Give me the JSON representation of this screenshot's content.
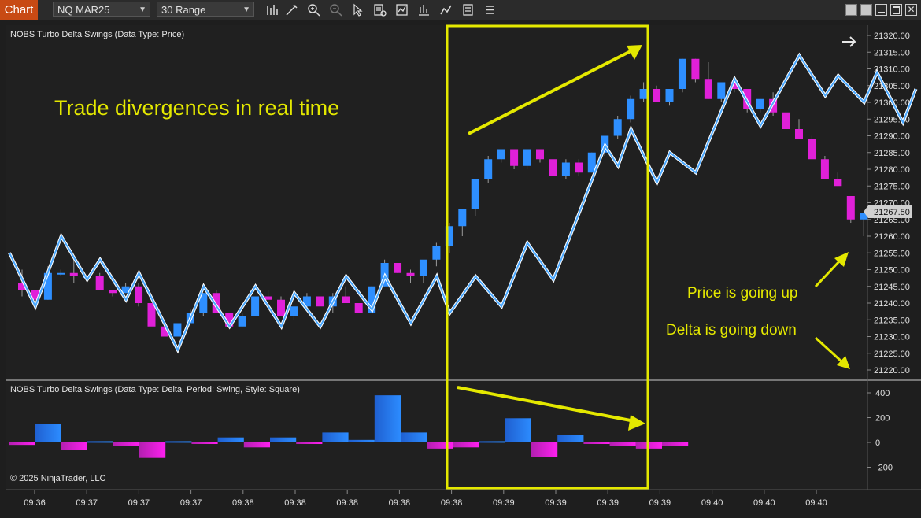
{
  "toolbar": {
    "chart_tab": "Chart",
    "instrument": "NQ MAR25",
    "bar_type": "30 Range",
    "icons": [
      "bars-type-icon",
      "draw-tool-icon",
      "zoom-in-icon",
      "zoom-out-icon",
      "pointer-icon",
      "properties-icon",
      "indicators-icon",
      "strategies-icon",
      "chart-trader-icon",
      "templates-icon",
      "menu-icon"
    ],
    "window_buttons": [
      "tile-icon",
      "tile-icon-2",
      "minimize-icon",
      "maximize-icon",
      "close-icon"
    ]
  },
  "price_panel": {
    "title": "NOBS Turbo Delta Swings (Data Type: Price)",
    "price_ticks": [
      "21320.00",
      "21315.00",
      "21310.00",
      "21305.00",
      "21300.00",
      "21295.00",
      "21290.00",
      "21285.00",
      "21280.00",
      "21275.00",
      "21270.00",
      "21265.00",
      "21260.00",
      "21255.00",
      "21250.00",
      "21245.00",
      "21240.00",
      "21235.00",
      "21230.00",
      "21225.00",
      "21220.00"
    ],
    "current_price": "21267.50",
    "annotation_main": "Trade divergences in real time",
    "annotation_price": "Price is going up",
    "annotation_delta": "Delta is going down"
  },
  "delta_panel": {
    "title": "NOBS Turbo Delta Swings (Data Type: Delta, Period: Swing, Style: Square)",
    "ticks": [
      "400",
      "200",
      "0",
      "-200"
    ],
    "copyright": "© 2025 NinjaTrader, LLC"
  },
  "time_axis": [
    "09:36",
    "09:37",
    "09:37",
    "09:37",
    "09:38",
    "09:38",
    "09:38",
    "09:38",
    "09:38",
    "09:39",
    "09:39",
    "09:39",
    "09:39",
    "09:40",
    "09:40",
    "09:40"
  ],
  "colors": {
    "up": "#2e8fff",
    "down": "#e020d8",
    "swing_line": "#a8d8ff",
    "annotation": "#e4e800",
    "tab": "#c84a14"
  },
  "chart_data": [
    {
      "type": "candlestick",
      "title": "NOBS Turbo Delta Swings (Data Type: Price)",
      "ylim": [
        21218,
        21322
      ],
      "candles_ohlc": [
        [
          21246,
          21250,
          21242,
          21244
        ],
        [
          21244,
          21244,
          21240,
          21241
        ],
        [
          21241,
          21251,
          21241,
          21249
        ],
        [
          21249,
          21250,
          21248,
          21249
        ],
        [
          21249,
          21253,
          21246,
          21248
        ],
        [
          21248,
          21248,
          21247,
          21248
        ],
        [
          21248,
          21249,
          21244,
          21244
        ],
        [
          21244,
          21244,
          21242,
          21243
        ],
        [
          21243,
          21246,
          21243,
          21245
        ],
        [
          21245,
          21246,
          21239,
          21240
        ],
        [
          21240,
          21240,
          21234,
          21233
        ],
        [
          21233,
          21233,
          21230,
          21230
        ],
        [
          21230,
          21234,
          21230,
          21234
        ],
        [
          21234,
          21238,
          21234,
          21237
        ],
        [
          21237,
          21243,
          21236,
          21243
        ],
        [
          21243,
          21244,
          21238,
          21237
        ],
        [
          21237,
          21237,
          21233,
          21233
        ],
        [
          21233,
          21237,
          21233,
          21236
        ],
        [
          21236,
          21242,
          21236,
          21242
        ],
        [
          21242,
          21244,
          21240,
          21241
        ],
        [
          21241,
          21242,
          21236,
          21236
        ],
        [
          21236,
          21238,
          21235,
          21239
        ],
        [
          21239,
          21243,
          21238,
          21242
        ],
        [
          21242,
          21242,
          21240,
          21239
        ],
        [
          21239,
          21243,
          21237,
          21242
        ],
        [
          21242,
          21245,
          21240,
          21240
        ],
        [
          21240,
          21240,
          21237,
          21237
        ],
        [
          21237,
          21245,
          21237,
          21245
        ],
        [
          21245,
          21253,
          21245,
          21252
        ],
        [
          21252,
          21252,
          21249,
          21249
        ],
        [
          21249,
          21250,
          21246,
          21248
        ],
        [
          21248,
          21251,
          21246,
          21253
        ],
        [
          21253,
          21258,
          21251,
          21257
        ],
        [
          21257,
          21264,
          21255,
          21263
        ],
        [
          21263,
          21266,
          21260,
          21268
        ],
        [
          21268,
          21272,
          21266,
          21277
        ],
        [
          21277,
          21284,
          21276,
          21283
        ],
        [
          21283,
          21286,
          21282,
          21286
        ],
        [
          21286,
          21286,
          21280,
          21281
        ],
        [
          21281,
          21284,
          21280,
          21286
        ],
        [
          21286,
          21286,
          21282,
          21283
        ],
        [
          21283,
          21283,
          21278,
          21278
        ],
        [
          21278,
          21283,
          21277,
          21282
        ],
        [
          21282,
          21283,
          21278,
          21279
        ],
        [
          21279,
          21285,
          21279,
          21285
        ],
        [
          21285,
          21290,
          21284,
          21290
        ],
        [
          21290,
          21296,
          21289,
          21295
        ],
        [
          21295,
          21302,
          21294,
          21301
        ],
        [
          21301,
          21306,
          21300,
          21304
        ],
        [
          21304,
          21305,
          21300,
          21300
        ],
        [
          21300,
          21304,
          21299,
          21304
        ],
        [
          21304,
          21313,
          21303,
          21313
        ],
        [
          21313,
          21313,
          21306,
          21307
        ],
        [
          21307,
          21312,
          21301,
          21301
        ],
        [
          21301,
          21306,
          21300,
          21306
        ],
        [
          21306,
          21306,
          21303,
          21304
        ],
        [
          21304,
          21304,
          21297,
          21298
        ],
        [
          21298,
          21301,
          21297,
          21301
        ],
        [
          21301,
          21303,
          21296,
          21297
        ],
        [
          21297,
          21297,
          21292,
          21292
        ],
        [
          21292,
          21295,
          21289,
          21289
        ],
        [
          21289,
          21290,
          21285,
          21283
        ],
        [
          21283,
          21284,
          21278,
          21277
        ],
        [
          21277,
          21279,
          21275,
          21275
        ],
        [
          21272,
          21272,
          21264,
          21265
        ],
        [
          21265,
          21267,
          21260,
          21267
        ]
      ],
      "swing_points": [
        [
          0,
          21255
        ],
        [
          2,
          21239
        ],
        [
          4,
          21260
        ],
        [
          6,
          21247
        ],
        [
          7,
          21253
        ],
        [
          9,
          21241
        ],
        [
          10,
          21249
        ],
        [
          13,
          21226
        ],
        [
          15,
          21245
        ],
        [
          17,
          21233
        ],
        [
          19,
          21245
        ],
        [
          21,
          21233
        ],
        [
          22,
          21243
        ],
        [
          24,
          21233
        ],
        [
          26,
          21248
        ],
        [
          28,
          21238
        ],
        [
          29,
          21248
        ],
        [
          31,
          21234
        ],
        [
          33,
          21248
        ],
        [
          34,
          21237
        ],
        [
          36,
          21248
        ],
        [
          38,
          21239
        ],
        [
          40,
          21258
        ],
        [
          42,
          21247
        ],
        [
          46,
          21287
        ],
        [
          47,
          21281
        ],
        [
          48,
          21292
        ],
        [
          50,
          21276
        ],
        [
          51,
          21285
        ],
        [
          53,
          21279
        ],
        [
          56,
          21307
        ],
        [
          58,
          21293
        ],
        [
          61,
          21314
        ],
        [
          63,
          21302
        ],
        [
          64,
          21308
        ],
        [
          66,
          21300
        ],
        [
          67,
          21309
        ],
        [
          69,
          21294
        ],
        [
          70,
          21304
        ]
      ]
    },
    {
      "type": "bar",
      "title": "NOBS Turbo Delta Swings (Data Type: Delta, Period: Swing, Style: Square)",
      "ylim": [
        -300,
        450
      ],
      "values": [
        -20,
        150,
        -60,
        10,
        -30,
        -125,
        10,
        -10,
        40,
        -40,
        40,
        -10,
        80,
        20,
        380,
        80,
        -50,
        -40,
        10,
        195,
        -120,
        60,
        -10,
        -30,
        -50,
        -30
      ]
    }
  ]
}
